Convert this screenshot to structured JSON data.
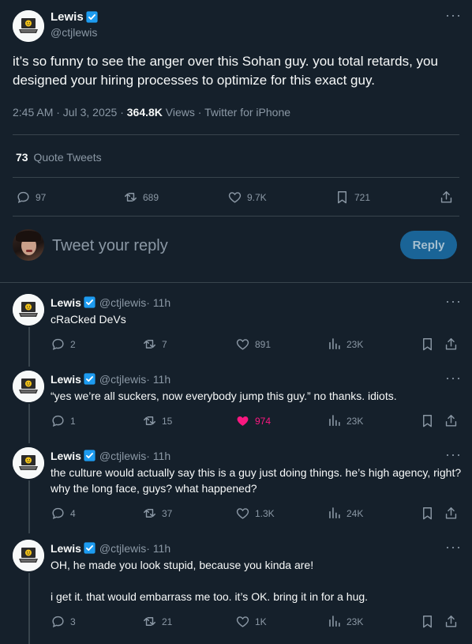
{
  "tweet": {
    "author_name": "Lewis",
    "author_handle": "@ctjlewis",
    "text": "it’s so funny to see the anger over this Sohan guy. you total retards, you designed your hiring processes to optimize for this exact guy.",
    "time": "2:45 AM · Jul 3, 2025 · ",
    "views_count": "364.8K",
    "views_label": " Views · Twitter for iPhone",
    "quote_count": "73",
    "quote_label": "Quote Tweets",
    "stats": {
      "replies": "97",
      "retweets": "689",
      "likes": "9.7K",
      "bookmarks": "721"
    }
  },
  "composer": {
    "placeholder": "Tweet your reply",
    "button": "Reply"
  },
  "replies": [
    {
      "name": "Lewis",
      "handle": "@ctjlewis",
      "time": " · 11h",
      "text": "cRaCked DeVs",
      "replies": "2",
      "retweets": "7",
      "likes": "891",
      "views": "23K",
      "liked": false
    },
    {
      "name": "Lewis",
      "handle": "@ctjlewis",
      "time": " · 11h",
      "text": "“yes we’re all suckers, now everybody jump this guy.” no thanks. idiots.",
      "replies": "1",
      "retweets": "15",
      "likes": "974",
      "views": "23K",
      "liked": true
    },
    {
      "name": "Lewis",
      "handle": "@ctjlewis",
      "time": " · 11h",
      "text": "the culture would actually say this is a guy just doing things. he’s high agency, right? why the long face, guys? what happened?",
      "replies": "4",
      "retweets": "37",
      "likes": "1.3K",
      "views": "24K",
      "liked": false
    },
    {
      "name": "Lewis",
      "handle": "@ctjlewis",
      "time": " · 11h",
      "text": "OH, he made you look stupid, because you kinda are!",
      "text2": "i get it. that would embarrass me too. it’s OK. bring it in for a hug.",
      "replies": "3",
      "retweets": "21",
      "likes": "1K",
      "views": "23K",
      "liked": false
    }
  ],
  "colors": {
    "background": "#15202b",
    "accent": "#1d9bf0",
    "like": "#f91880",
    "muted": "#8b98a5"
  }
}
